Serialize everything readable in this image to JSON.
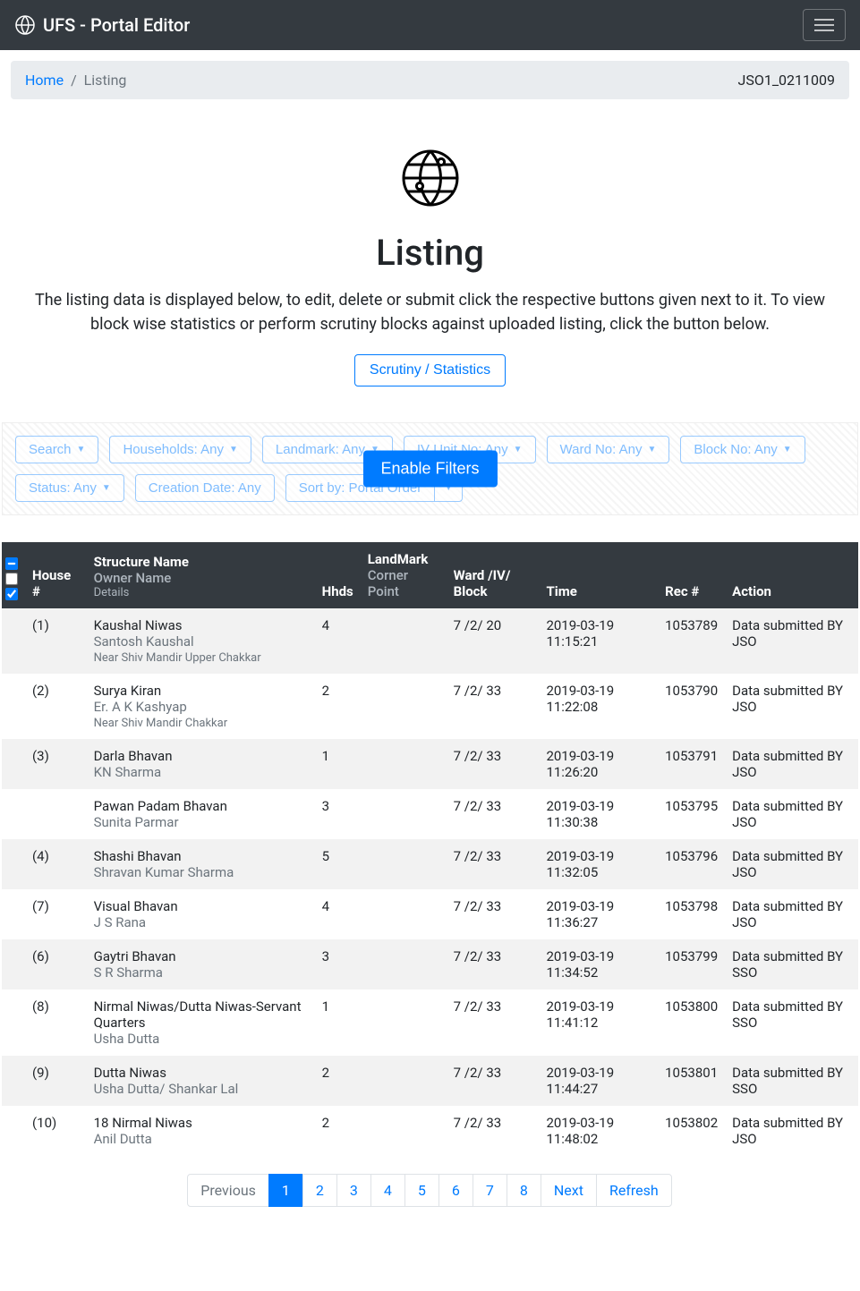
{
  "brand": "UFS - Portal Editor",
  "breadcrumb": {
    "home": "Home",
    "sep": "/",
    "current": "Listing"
  },
  "user_id": "JSO1_0211009",
  "hero": {
    "title": "Listing",
    "desc": "The listing data is displayed below, to edit, delete or submit click the respective buttons given next to it. To view block wise statistics or perform scrutiny blocks against uploaded listing, click the button below.",
    "cta": "Scrutiny / Statistics"
  },
  "filters": {
    "search": "Search",
    "households": "Households: Any",
    "landmark": "Landmark: Any",
    "ivunit": "IV Unit No: Any",
    "ward": "Ward No: Any",
    "block": "Block No: Any",
    "status": "Status: Any",
    "creation": "Creation Date: Any",
    "sort": "Sort by: Portal Order",
    "enable": "Enable Filters"
  },
  "headers": {
    "house": "House #",
    "structure": "Structure Name",
    "owner": "Owner Name",
    "details": "Details",
    "hhds": "Hhds",
    "landmark": "LandMark",
    "corner": "Corner Point",
    "ward": "Ward /IV/ Block",
    "time": "Time",
    "rec": "Rec #",
    "action": "Action"
  },
  "rows": [
    {
      "idx": "(1)",
      "structure": "Kaushal Niwas",
      "owner": "Santosh Kaushal",
      "details": "Near Shiv Mandir Upper Chakkar",
      "hhds": "4",
      "landmark": "",
      "ward": "7 /2/ 20",
      "time": "2019-03-19 11:15:21",
      "rec": "1053789",
      "action": "Data submitted BY JSO"
    },
    {
      "idx": "(2)",
      "structure": "Surya Kiran",
      "owner": "Er. A K Kashyap",
      "details": "Near Shiv Mandir Chakkar",
      "hhds": "2",
      "landmark": "",
      "ward": "7 /2/ 33",
      "time": "2019-03-19 11:22:08",
      "rec": "1053790",
      "action": "Data submitted BY JSO"
    },
    {
      "idx": "(3)",
      "structure": "Darla Bhavan",
      "owner": "KN Sharma",
      "details": "",
      "hhds": "1",
      "landmark": "",
      "ward": "7 /2/ 33",
      "time": "2019-03-19 11:26:20",
      "rec": "1053791",
      "action": "Data submitted BY JSO"
    },
    {
      "idx": "",
      "structure": "Pawan Padam Bhavan",
      "owner": "Sunita Parmar",
      "details": "",
      "hhds": "3",
      "landmark": "",
      "ward": "7 /2/ 33",
      "time": "2019-03-19 11:30:38",
      "rec": "1053795",
      "action": "Data submitted BY JSO"
    },
    {
      "idx": "(4)",
      "structure": "Shashi Bhavan",
      "owner": "Shravan Kumar Sharma",
      "details": "",
      "hhds": "5",
      "landmark": "",
      "ward": "7 /2/ 33",
      "time": "2019-03-19 11:32:05",
      "rec": "1053796",
      "action": "Data submitted BY JSO"
    },
    {
      "idx": "(7)",
      "structure": "Visual Bhavan",
      "owner": "J S Rana",
      "details": "",
      "hhds": "4",
      "landmark": "",
      "ward": "7 /2/ 33",
      "time": "2019-03-19 11:36:27",
      "rec": "1053798",
      "action": "Data submitted BY JSO"
    },
    {
      "idx": "(6)",
      "structure": "Gaytri Bhavan",
      "owner": "S R Sharma",
      "details": "",
      "hhds": "3",
      "landmark": "",
      "ward": "7 /2/ 33",
      "time": "2019-03-19 11:34:52",
      "rec": "1053799",
      "action": "Data submitted BY SSO"
    },
    {
      "idx": "(8)",
      "structure": "Nirmal Niwas/Dutta Niwas-Servant Quarters",
      "owner": "Usha Dutta",
      "details": "",
      "hhds": "1",
      "landmark": "",
      "ward": "7 /2/ 33",
      "time": "2019-03-19 11:41:12",
      "rec": "1053800",
      "action": "Data submitted BY SSO"
    },
    {
      "idx": "(9)",
      "structure": "Dutta Niwas",
      "owner": "Usha Dutta/ Shankar Lal",
      "details": "",
      "hhds": "2",
      "landmark": "",
      "ward": "7 /2/ 33",
      "time": "2019-03-19 11:44:27",
      "rec": "1053801",
      "action": "Data submitted BY SSO"
    },
    {
      "idx": "(10)",
      "structure": "18 Nirmal Niwas",
      "owner": "Anil Dutta",
      "details": "",
      "hhds": "2",
      "landmark": "",
      "ward": "7 /2/ 33",
      "time": "2019-03-19 11:48:02",
      "rec": "1053802",
      "action": "Data submitted BY JSO"
    }
  ],
  "pagination": {
    "prev": "Previous",
    "pages": [
      "1",
      "2",
      "3",
      "4",
      "5",
      "6",
      "7",
      "8"
    ],
    "next": "Next",
    "refresh": "Refresh"
  }
}
